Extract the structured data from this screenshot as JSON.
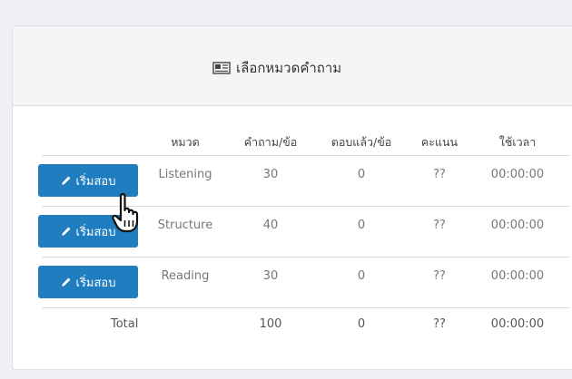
{
  "panel": {
    "title": "เลือกหมวดคำถาม",
    "title_icon": "newspaper-icon"
  },
  "table": {
    "headers": [
      "หมวด",
      "คำถาม/ข้อ",
      "ตอบแล้ว/ข้อ",
      "คะแนน",
      "ใช้เวลา"
    ],
    "rows": [
      {
        "button": "เริ่มสอบ",
        "category": "Listening",
        "questions": "30",
        "answered": "0",
        "score": "??",
        "time": "00:00:00"
      },
      {
        "button": "เริ่มสอบ",
        "category": "Structure",
        "questions": "40",
        "answered": "0",
        "score": "??",
        "time": "00:00:00"
      },
      {
        "button": "เริ่มสอบ",
        "category": "Reading",
        "questions": "30",
        "answered": "0",
        "score": "??",
        "time": "00:00:00"
      }
    ],
    "total": {
      "label": "Total",
      "questions": "100",
      "answered": "0",
      "score": "??",
      "time": "00:00:00"
    }
  },
  "colors": {
    "button": "#1f7dc0",
    "header_bg": "#f5f5f5"
  },
  "cursor": "hand-pointer-icon"
}
